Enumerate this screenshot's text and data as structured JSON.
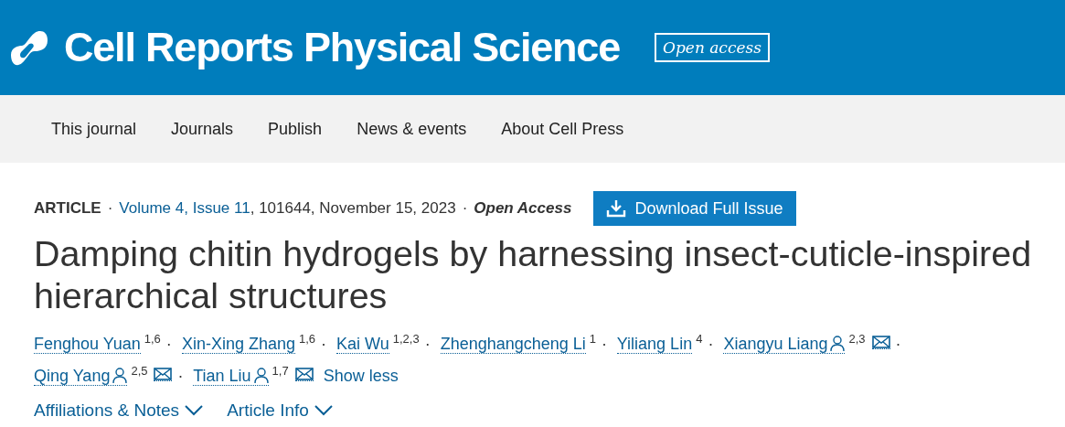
{
  "header": {
    "journal_title": "Cell Reports Physical Science",
    "badge": "Open access"
  },
  "nav": [
    {
      "label": "This journal"
    },
    {
      "label": "Journals"
    },
    {
      "label": "Publish"
    },
    {
      "label": "News & events"
    },
    {
      "label": "About Cell Press"
    }
  ],
  "meta": {
    "type": "ARTICLE",
    "sep1": "·",
    "volume_link": "Volume 4, Issue 11",
    "details": ", 101644, November 15, 2023",
    "sep2": "·",
    "access": "Open Access"
  },
  "download_button": "Download Full Issue",
  "title": "Damping chitin hydrogels by harnessing insect-cuticle-inspired hierarchical structures",
  "authors": [
    {
      "name": "Fenghou Yuan",
      "affiliations": "1,6",
      "corresponding": false,
      "separator": "·"
    },
    {
      "name": "Xin-Xing Zhang",
      "affiliations": "1,6",
      "corresponding": false,
      "separator": "·"
    },
    {
      "name": "Kai Wu",
      "affiliations": "1,2,3",
      "corresponding": false,
      "separator": "·"
    },
    {
      "name": "Zhenghangcheng Li",
      "affiliations": "1",
      "corresponding": false,
      "separator": "·"
    },
    {
      "name": "Yiliang Lin",
      "affiliations": "4",
      "corresponding": false,
      "separator": "·"
    },
    {
      "name": "Xiangyu Liang",
      "affiliations": "2,3",
      "corresponding": true,
      "separator": "·"
    },
    {
      "name": "Qing Yang",
      "affiliations": "2,5",
      "corresponding": true,
      "separator": "·"
    },
    {
      "name": "Tian Liu",
      "affiliations": "1,7",
      "corresponding": true
    }
  ],
  "show_less": "Show less",
  "toggles": [
    {
      "label": "Affiliations & Notes",
      "expanded": false
    },
    {
      "label": "Article Info",
      "expanded": false
    }
  ]
}
